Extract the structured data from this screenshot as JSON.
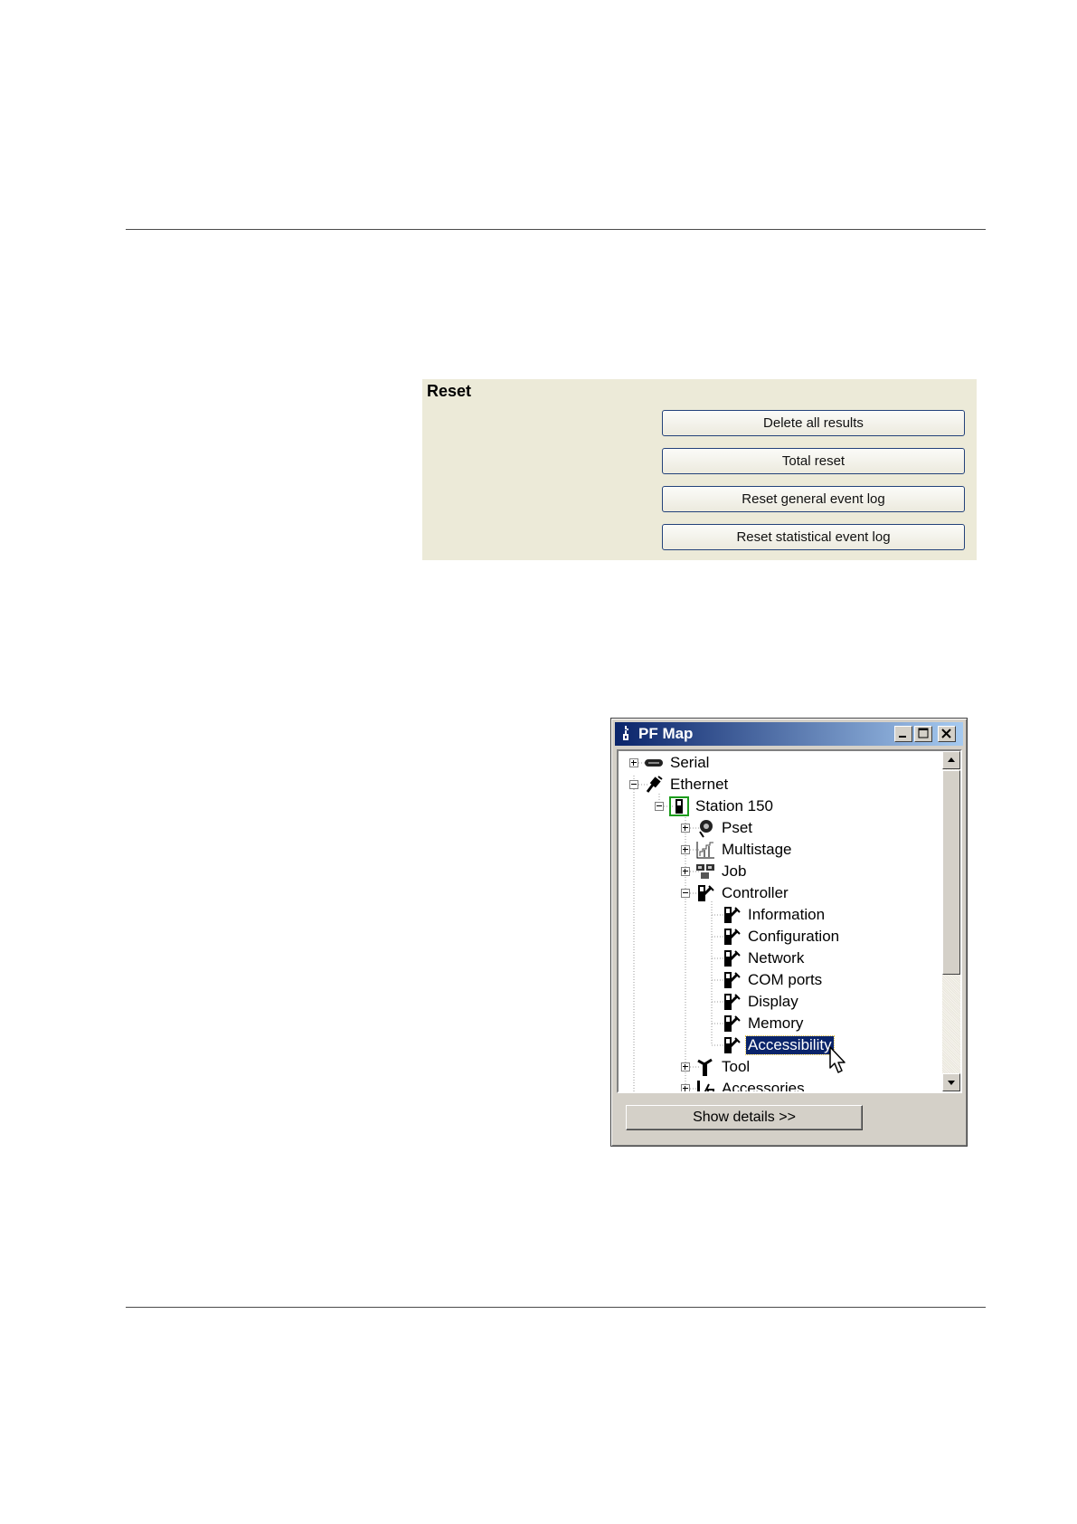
{
  "reset": {
    "title": "Reset",
    "buttons": [
      {
        "label": "Delete all results"
      },
      {
        "label": "Total reset"
      },
      {
        "label": "Reset general event log"
      },
      {
        "label": "Reset statistical event log"
      }
    ]
  },
  "pfmap": {
    "title": "PF Map",
    "tree": [
      {
        "label": "Serial",
        "icon": "serial-port-icon"
      },
      {
        "label": "Ethernet",
        "icon": "ethernet-plug-icon"
      },
      {
        "label": "Station 150",
        "icon": "station-icon"
      },
      {
        "label": "Pset",
        "icon": "pset-icon"
      },
      {
        "label": "Multistage",
        "icon": "multistage-icon"
      },
      {
        "label": "Job",
        "icon": "job-icon"
      },
      {
        "label": "Controller",
        "icon": "controller-icon"
      },
      {
        "label": "Information",
        "icon": "controller-icon"
      },
      {
        "label": "Configuration",
        "icon": "controller-icon"
      },
      {
        "label": "Network",
        "icon": "controller-icon"
      },
      {
        "label": "COM ports",
        "icon": "controller-icon"
      },
      {
        "label": "Display",
        "icon": "controller-icon"
      },
      {
        "label": "Memory",
        "icon": "controller-icon"
      },
      {
        "label": "Accessibility",
        "icon": "controller-icon",
        "selected": true
      },
      {
        "label": "Tool",
        "icon": "tool-icon"
      },
      {
        "label": "Accessories",
        "icon": "accessories-icon"
      }
    ],
    "details_button": "Show details >>"
  },
  "colors": {
    "panel_bg": "#ecead8",
    "button_border": "#23427a",
    "titlebar_start": "#0a246a",
    "titlebar_end": "#a6caf0",
    "selection": "#0a246a"
  }
}
